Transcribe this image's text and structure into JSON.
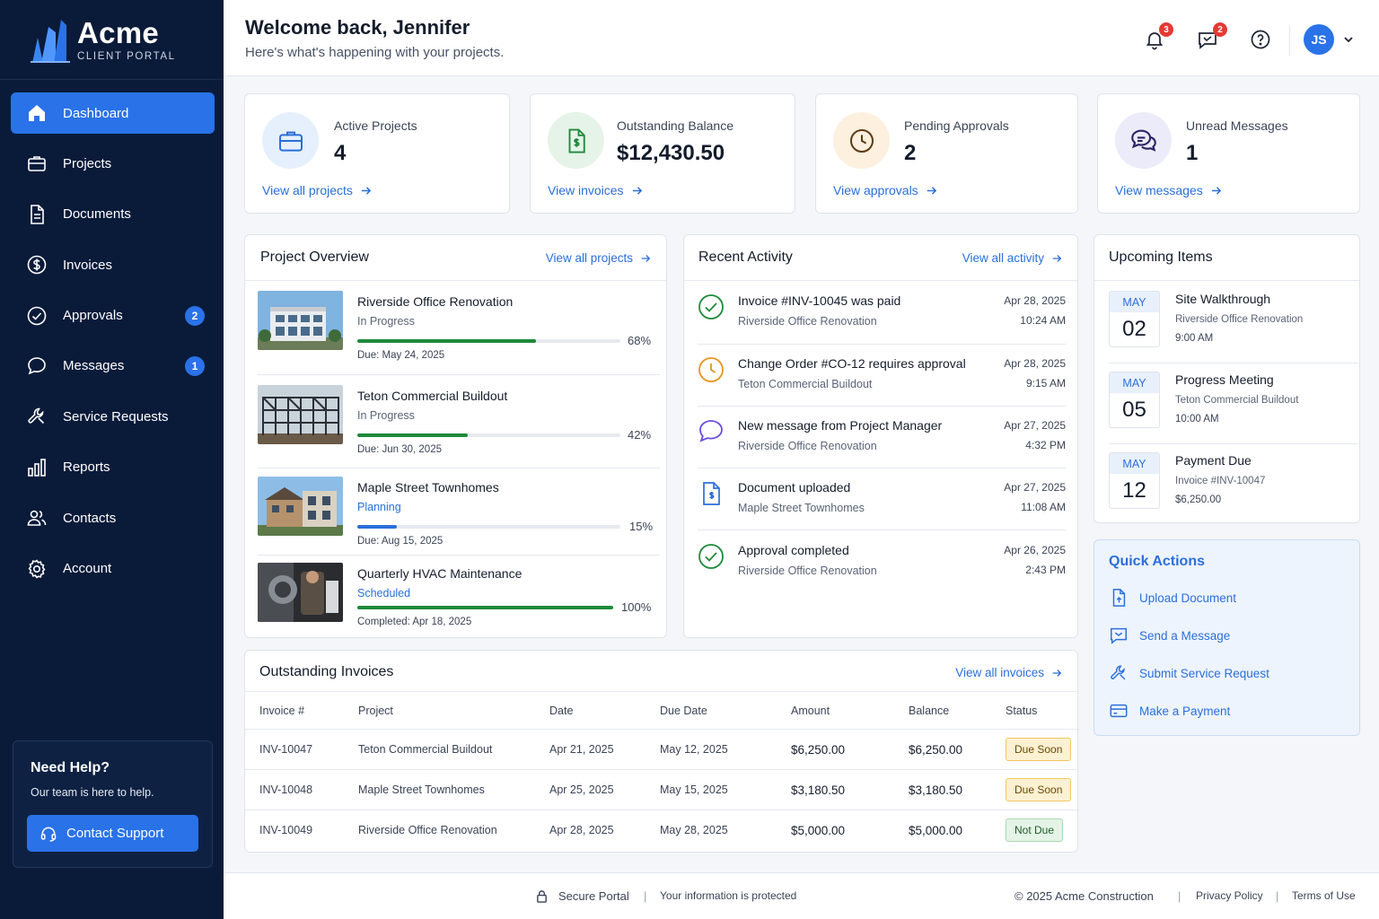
{
  "brand": {
    "name": "Acme",
    "subtitle": "CLIENT PORTAL"
  },
  "sidebar": {
    "items": [
      {
        "label": "Dashboard",
        "icon": "home-icon",
        "active": true
      },
      {
        "label": "Projects",
        "icon": "briefcase-icon"
      },
      {
        "label": "Documents",
        "icon": "document-icon"
      },
      {
        "label": "Invoices",
        "icon": "dollar-circle-icon"
      },
      {
        "label": "Approvals",
        "icon": "check-circle-icon",
        "badge": "2"
      },
      {
        "label": "Messages",
        "icon": "chat-bubble-icon",
        "badge": "1"
      },
      {
        "label": "Service Requests",
        "icon": "wrench-icon"
      },
      {
        "label": "Reports",
        "icon": "bar-chart-icon"
      },
      {
        "label": "Contacts",
        "icon": "users-icon"
      },
      {
        "label": "Account",
        "icon": "gear-icon"
      }
    ],
    "help": {
      "title": "Need Help?",
      "text": "Our team is here to help.",
      "button": "Contact Support"
    }
  },
  "header": {
    "title": "Welcome back, Jennifer",
    "subtitle": "Here's what's happening with your projects.",
    "notifications": "3",
    "messages": "2",
    "avatar": "JS"
  },
  "stats": [
    {
      "label": "Active Projects",
      "value": "4",
      "link": "View all projects",
      "icon": "briefcase-icon",
      "color": "#2a6fdb"
    },
    {
      "label": "Outstanding Balance",
      "value": "$12,430.50",
      "link": "View invoices",
      "icon": "invoice-icon",
      "color": "#1e8a3a"
    },
    {
      "label": "Pending Approvals",
      "value": "2",
      "link": "View approvals",
      "icon": "clock-icon",
      "color": "#b8631a"
    },
    {
      "label": "Unread Messages",
      "value": "1",
      "link": "View messages",
      "icon": "chat-bubbles-icon",
      "color": "#4a3d9e"
    }
  ],
  "overview": {
    "title": "Project Overview",
    "link": "View all projects",
    "projects": [
      {
        "name": "Riverside Office Renovation",
        "status": "In Progress",
        "progress": 68,
        "pct": "68%",
        "due": "Due: May 24, 2025"
      },
      {
        "name": "Teton Commercial Buildout",
        "status": "In Progress",
        "progress": 42,
        "pct": "42%",
        "due": "Due: Jun 30, 2025"
      },
      {
        "name": "Maple Street Townhomes",
        "status": "Planning",
        "progress": 15,
        "pct": "15%",
        "due": "Due: Aug 15, 2025"
      },
      {
        "name": "Quarterly HVAC Maintenance",
        "status": "Scheduled",
        "progress": 100,
        "pct": "100%",
        "due": "Completed: Apr 18, 2025"
      }
    ]
  },
  "activity": {
    "title": "Recent Activity",
    "link": "View all activity",
    "items": [
      {
        "title": "Invoice #INV-10045 was paid",
        "sub": "Riverside Office Renovation",
        "date": "Apr 28, 2025",
        "time": "10:24 AM",
        "icon": "check-circle-icon"
      },
      {
        "title": "Change Order #CO-12 requires approval",
        "sub": "Teton Commercial Buildout",
        "date": "Apr 28, 2025",
        "time": "9:15 AM",
        "icon": "clock-icon"
      },
      {
        "title": "New message from Project Manager",
        "sub": "Riverside Office Renovation",
        "date": "Apr 27, 2025",
        "time": "4:32 PM",
        "icon": "chat-bubble-icon"
      },
      {
        "title": "Document uploaded",
        "sub": "Maple Street Townhomes",
        "date": "Apr 27, 2025",
        "time": "11:08 AM",
        "icon": "document-icon"
      },
      {
        "title": "Approval completed",
        "sub": "Riverside Office Renovation",
        "date": "Apr 26, 2025",
        "time": "2:43 PM",
        "icon": "check-circle-icon"
      }
    ]
  },
  "upcoming": {
    "title": "Upcoming Items",
    "items": [
      {
        "month": "MAY",
        "day": "02",
        "title": "Site Walkthrough",
        "sub": "Riverside Office Renovation",
        "time": "9:00 AM"
      },
      {
        "month": "MAY",
        "day": "05",
        "title": "Progress Meeting",
        "sub": "Teton Commercial Buildout",
        "time": "10:00 AM"
      },
      {
        "month": "MAY",
        "day": "12",
        "title": "Payment Due",
        "sub": "Invoice #INV-10047",
        "time": "$6,250.00"
      }
    ]
  },
  "quick": {
    "title": "Quick Actions",
    "items": [
      "Upload Document",
      "Send a Message",
      "Submit Service Request",
      "Make a Payment"
    ]
  },
  "invoices": {
    "title": "Outstanding Invoices",
    "link": "View all invoices",
    "columns": [
      "Invoice #",
      "Project",
      "Date",
      "Due Date",
      "Amount",
      "Balance",
      "Status"
    ],
    "rows": [
      {
        "id": "INV-10047",
        "project": "Teton Commercial Buildout",
        "date": "Apr 21, 2025",
        "due": "May 12, 2025",
        "amount": "$6,250.00",
        "balance": "$6,250.00",
        "status": "Due Soon"
      },
      {
        "id": "INV-10048",
        "project": "Maple Street Townhomes",
        "date": "Apr 25, 2025",
        "due": "May 15, 2025",
        "amount": "$3,180.50",
        "balance": "$3,180.50",
        "status": "Due Soon"
      },
      {
        "id": "INV-10049",
        "project": "Riverside Office Renovation",
        "date": "Apr 28, 2025",
        "due": "May 28, 2025",
        "amount": "$5,000.00",
        "balance": "$5,000.00",
        "status": "Not Due"
      }
    ]
  },
  "footer": {
    "secure": "Secure Portal",
    "protected": "Your information is protected",
    "copyright": "© 2025 Acme Construction",
    "privacy": "Privacy Policy",
    "terms": "Terms of Use"
  }
}
